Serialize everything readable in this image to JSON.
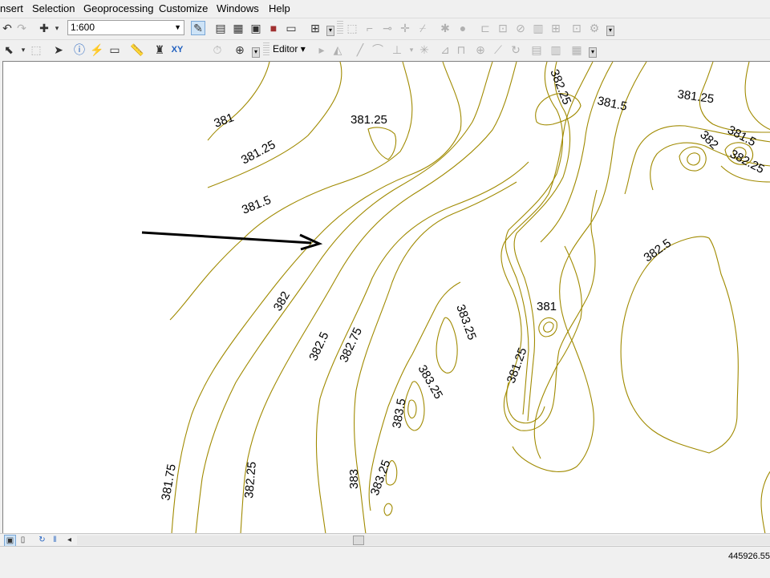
{
  "menubar": {
    "items": [
      "nsert",
      "Selection",
      "Geoprocessing",
      "Customize",
      "Windows",
      "Help"
    ]
  },
  "toolbar": {
    "scale_value": "1:600",
    "editor_label": "Editor",
    "icons_row1": [
      "undo-icon",
      "redo-icon",
      "add-data-icon",
      "scale-dropdown",
      "editor-toolbar-icon",
      "table-of-contents-icon",
      "catalog-icon",
      "search-window-icon",
      "arctoolbox-icon",
      "python-window-icon",
      "model-builder-icon"
    ],
    "icons_row2": [
      "select-elements-icon",
      "clear-selection-icon",
      "select-features-icon",
      "identify-icon",
      "hyperlink-icon",
      "html-popup-icon",
      "measure-icon",
      "find-icon",
      "go-to-xy-icon",
      "time-slider-icon",
      "magnifier-icon"
    ]
  },
  "map": {
    "contour_color": "#a08a00",
    "contour_labels": [
      "381",
      "381.25",
      "381.5",
      "381.25",
      "382.25",
      "381.5",
      "381.25",
      "382",
      "381.5",
      "382.25",
      "382.5",
      "382",
      "382.5",
      "382.75",
      "383.25",
      "381",
      "381.25",
      "383.25",
      "383.5",
      "383",
      "383.25",
      "381.75",
      "382.25"
    ]
  },
  "statusbar": {
    "coordinates": "445926.55"
  }
}
